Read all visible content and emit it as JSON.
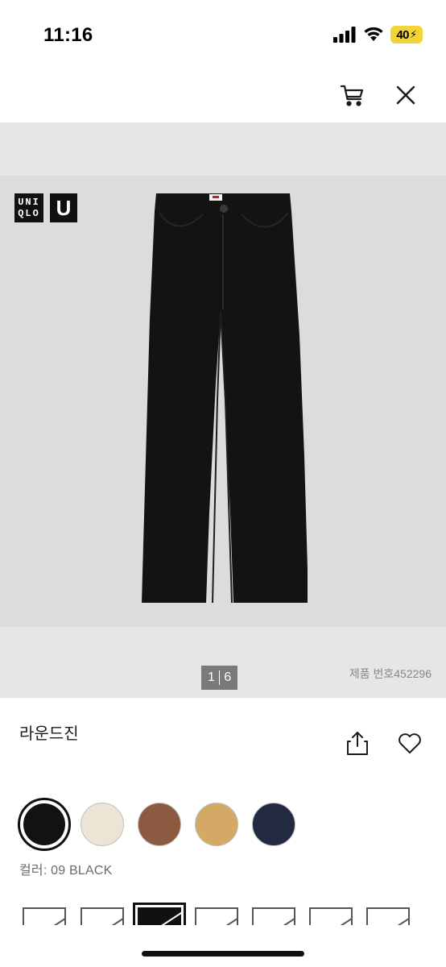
{
  "status_bar": {
    "time": "11:16",
    "battery": "40",
    "icons": [
      "signal-icon",
      "wifi-icon",
      "battery-icon"
    ]
  },
  "top_nav": {
    "icons": [
      "cart-icon",
      "close-icon"
    ]
  },
  "gallery": {
    "brand_logo_text": [
      "UNI",
      "QLO"
    ],
    "sub_brand_logo": "U",
    "pager_current": "1",
    "pager_total": "6",
    "product_number": "제품 번호452296",
    "product_image_color": "#131313"
  },
  "product": {
    "title": "라운드진",
    "icons": [
      "share-icon",
      "heart-icon"
    ]
  },
  "colors": {
    "swatches": [
      {
        "name": "black",
        "hex": "#121212",
        "selected": true
      },
      {
        "name": "off-white",
        "hex": "#ece4d4",
        "selected": false
      },
      {
        "name": "brown",
        "hex": "#8c5a40",
        "selected": false
      },
      {
        "name": "mustard",
        "hex": "#d3a965",
        "selected": false
      },
      {
        "name": "navy",
        "hex": "#222a42",
        "selected": false
      }
    ],
    "label": "컬러: 09 BLACK"
  },
  "sizes": {
    "count": 7,
    "selected_index": 2
  }
}
